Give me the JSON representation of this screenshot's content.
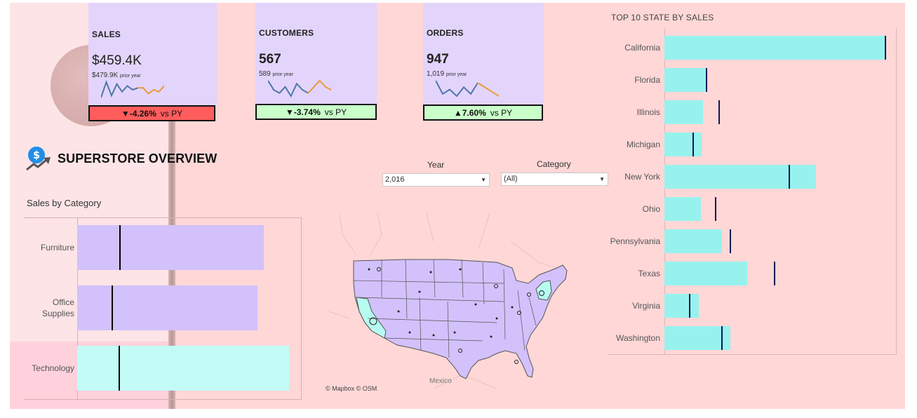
{
  "colors": {
    "background": "#ffd7d7",
    "kpi_card": "#e3d4fb",
    "badge_down_strong": "#ff5c5c",
    "badge_down_light": "#c9ffc9",
    "badge_up": "#c9ffc9",
    "category_bar_purple": "#d3c1fb",
    "category_bar_teal": "#c3fcf7",
    "state_bar": "#97f2ee",
    "reference_line": "#0d1a55",
    "spark_blue": "#4f78a8",
    "spark_orange": "#e89b3a"
  },
  "kpis": [
    {
      "title": "SALES",
      "value": "$459.4K",
      "prior_value": "$479.9K",
      "prior_label": "prior year",
      "change": "▼-4.26%",
      "vs_label": "vs PY",
      "badge_color": "#ff5c5c",
      "spark_blue": [
        6,
        22,
        8,
        20,
        12,
        18,
        14,
        16
      ],
      "spark_orange": [
        16,
        10,
        14,
        12,
        18,
        20
      ]
    },
    {
      "title": "CUSTOMERS",
      "value": "567",
      "prior_value": "589",
      "prior_label": "prior year",
      "change": "▼-3.74%",
      "vs_label": "vs PY",
      "badge_color": "#c9ffc9",
      "spark_blue": [
        14,
        8,
        6,
        10,
        4,
        12,
        8,
        6
      ],
      "spark_orange": [
        10,
        14,
        10,
        8,
        14
      ]
    },
    {
      "title": "ORDERS",
      "value": "947",
      "prior_value": "1,019",
      "prior_label": "prior year",
      "change": "▲7.60%",
      "vs_label": "vs PY",
      "badge_color": "#c9ffc9",
      "spark_blue": [
        20,
        8,
        12,
        6,
        14,
        8,
        18
      ],
      "spark_orange": [
        14,
        10,
        6,
        18
      ]
    }
  ],
  "header": {
    "title": "SUPERSTORE OVERVIEW",
    "logo_icon": "dollar-growth-icon"
  },
  "filters": {
    "year_label": "Year",
    "year_value": "2,016",
    "category_label": "Category",
    "category_value": "(All)"
  },
  "sales_by_category": {
    "title": "Sales by Category",
    "chart_data": {
      "type": "bar",
      "orientation": "horizontal",
      "categories": [
        "Furniture",
        "Office\nSupplies",
        "Technology"
      ],
      "values": [
        266,
        257,
        302
      ],
      "reference_values": [
        60,
        49,
        59
      ],
      "colors": [
        "#d3c1fb",
        "#d3c1fb",
        "#c3fcf7"
      ],
      "xlim": [
        0,
        310
      ]
    }
  },
  "map": {
    "credit": "© Mapbox © OSM",
    "mexico_label": "Mexico",
    "highlighted_states": [
      "California",
      "New York"
    ]
  },
  "top_states": {
    "title": "TOP 10 STATE BY SALES",
    "chart_data": {
      "type": "bar",
      "orientation": "horizontal",
      "categories": [
        "California",
        "Florida",
        "Illinois",
        "Michigan",
        "New York",
        "Ohio",
        "Pennsylvania",
        "Texas",
        "Virginia",
        "Washington"
      ],
      "values": [
        316,
        60,
        55,
        53,
        216,
        52,
        82,
        118,
        49,
        94
      ],
      "reference_values": [
        314,
        59,
        77,
        40,
        177,
        72,
        93,
        156,
        35,
        81
      ],
      "xlim": [
        0,
        330
      ]
    }
  }
}
